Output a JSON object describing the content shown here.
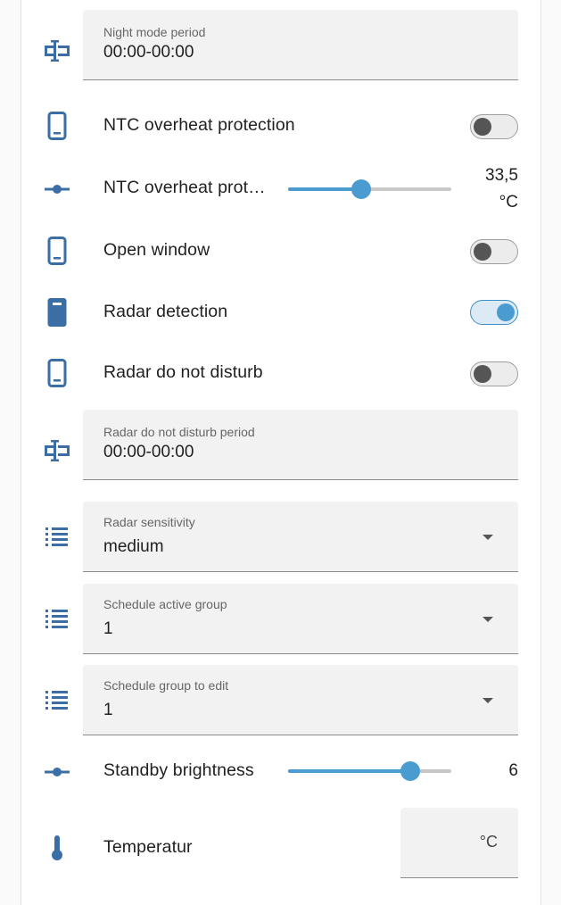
{
  "colors": {
    "accent": "#4a9bd0",
    "icon": "#3a6ea5",
    "field_bg": "#f2f2f2"
  },
  "rows": {
    "night_mode": {
      "label": "Night mode period",
      "value": "00:00-00:00",
      "icon": "timer-text-icon"
    },
    "ntc_protection": {
      "label": "NTC overheat protection",
      "on": false,
      "icon": "device-icon"
    },
    "ntc_slider": {
      "label": "NTC overheat prot…",
      "value_fraction": 0.45,
      "value": "33,5",
      "unit": "°C",
      "icon": "slider-icon"
    },
    "open_window": {
      "label": "Open window",
      "on": false,
      "icon": "device-icon"
    },
    "radar_detection": {
      "label": "Radar detection",
      "on": true,
      "icon": "device-filled-icon"
    },
    "radar_dnd": {
      "label": "Radar do not disturb",
      "on": false,
      "icon": "device-icon"
    },
    "radar_dnd_period": {
      "label": "Radar do not disturb period",
      "value": "00:00-00:00",
      "icon": "timer-text-icon"
    },
    "radar_sensitivity": {
      "label": "Radar sensitivity",
      "value": "medium",
      "icon": "list-icon"
    },
    "schedule_active": {
      "label": "Schedule active group",
      "value": "1",
      "icon": "list-icon"
    },
    "schedule_edit": {
      "label": "Schedule group to edit",
      "value": "1",
      "icon": "list-icon"
    },
    "standby_brightness": {
      "label": "Standby brightness",
      "value_fraction": 0.75,
      "value": "6",
      "icon": "slider-icon"
    },
    "temperatur": {
      "label": "Temperatur",
      "unit": "°C",
      "icon": "thermometer-icon"
    }
  }
}
